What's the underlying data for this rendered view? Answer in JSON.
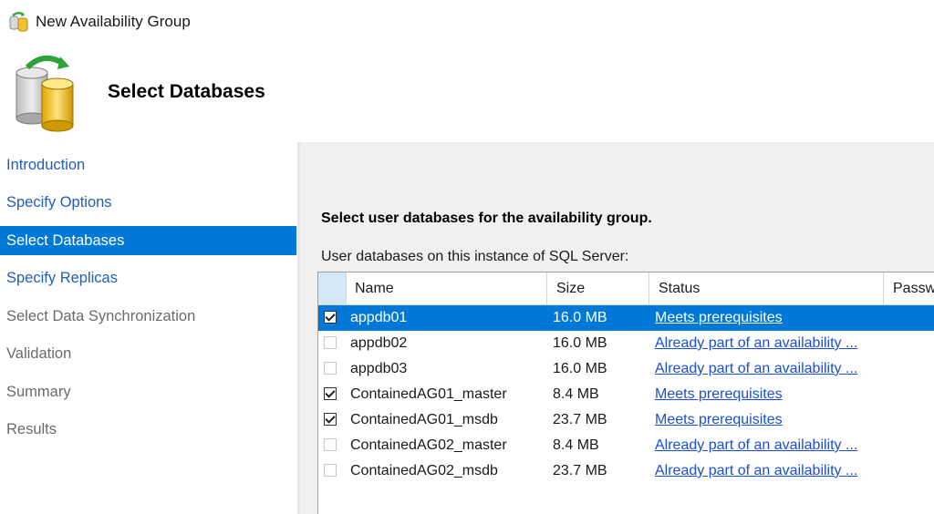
{
  "window": {
    "title": "New Availability Group"
  },
  "banner": {
    "heading": "Select Databases"
  },
  "nav": {
    "items": [
      {
        "label": "Introduction",
        "state": "link"
      },
      {
        "label": "Specify Options",
        "state": "link"
      },
      {
        "label": "Select Databases",
        "state": "selected"
      },
      {
        "label": "Specify Replicas",
        "state": "link"
      },
      {
        "label": "Select Data Synchronization",
        "state": "disabled"
      },
      {
        "label": "Validation",
        "state": "disabled"
      },
      {
        "label": "Summary",
        "state": "disabled"
      },
      {
        "label": "Results",
        "state": "disabled"
      }
    ]
  },
  "main": {
    "instruction": "Select user databases for the availability group.",
    "grid_label": "User databases on this instance of SQL Server:",
    "columns": [
      "Name",
      "Size",
      "Status",
      "Passw"
    ],
    "rows": [
      {
        "checked": true,
        "name": "appdb01",
        "size": "16.0 MB",
        "status": "Meets prerequisites",
        "selected": true
      },
      {
        "checked": false,
        "name": "appdb02",
        "size": "16.0 MB",
        "status": "Already part of an availability ...",
        "selected": false
      },
      {
        "checked": false,
        "name": "appdb03",
        "size": "16.0 MB",
        "status": "Already part of an availability ...",
        "selected": false
      },
      {
        "checked": true,
        "name": "ContainedAG01_master",
        "size": "8.4 MB",
        "status": "Meets prerequisites",
        "selected": false
      },
      {
        "checked": true,
        "name": "ContainedAG01_msdb",
        "size": "23.7 MB",
        "status": "Meets prerequisites",
        "selected": false
      },
      {
        "checked": false,
        "name": "ContainedAG02_master",
        "size": "8.4 MB",
        "status": "Already part of an availability ...",
        "selected": false
      },
      {
        "checked": false,
        "name": "ContainedAG02_msdb",
        "size": "23.7 MB",
        "status": "Already part of an availability ...",
        "selected": false
      }
    ]
  },
  "colors": {
    "selection": "#0078d7",
    "nav_link": "#1f5fb4",
    "nav_disabled": "#6b6b6b",
    "status_link": "#1a4fd6",
    "content_bg": "#f0f0f0"
  },
  "icons": {
    "app": "availability-group-icon",
    "banner": "database-sync-icon"
  }
}
